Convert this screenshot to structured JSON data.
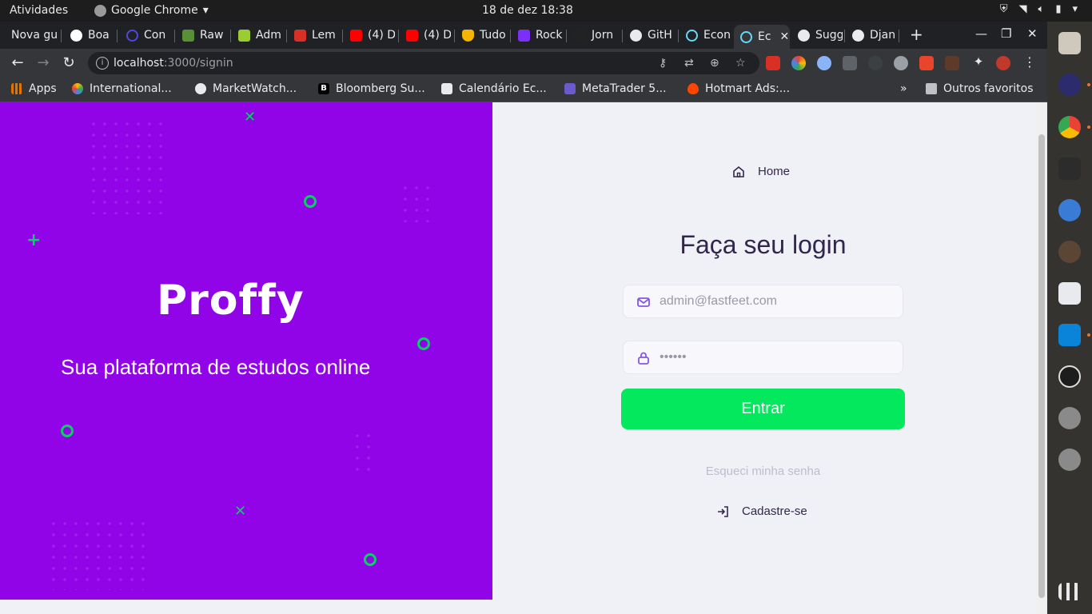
{
  "topbar": {
    "activities": "Atividades",
    "app_name": "Google Chrome",
    "clock": "18 de dez  18:38"
  },
  "tabs": [
    {
      "label": "Nova gu",
      "color": "#202124"
    },
    {
      "label": "Boa",
      "color": "#ffffff"
    },
    {
      "label": "Con",
      "color": "#4f46e5"
    },
    {
      "label": "Raw",
      "color": "#5a8f3a"
    },
    {
      "label": "Adm",
      "color": "#9acd32"
    },
    {
      "label": "Lem",
      "color": "#d93025"
    },
    {
      "label": "(4) D",
      "color": "#ff0000"
    },
    {
      "label": "(4) D",
      "color": "#ff0000"
    },
    {
      "label": "Tudo",
      "color": "#f4b400"
    },
    {
      "label": "Rock",
      "color": "#7b2ff7"
    },
    {
      "label": "Jorn",
      "color": "#222222"
    },
    {
      "label": "GitH",
      "color": "#e8eaed"
    },
    {
      "label": "Econ",
      "color": "#61dafb"
    },
    {
      "label": "Ec",
      "color": "#61dafb"
    },
    {
      "label": "Sugg",
      "color": "#e8eaed"
    },
    {
      "label": "Djan",
      "color": "#e8eaed"
    }
  ],
  "toolbar": {
    "url_host": "localhost",
    "url_path": ":3000/signin"
  },
  "bookmarks": [
    {
      "label": "Apps",
      "color": "#e37400"
    },
    {
      "label": "International...",
      "color": "#e8eaed"
    },
    {
      "label": "MarketWatch...",
      "color": "#e8eaed"
    },
    {
      "label": "Bloomberg Su...",
      "color": "#000000"
    },
    {
      "label": "Calendário Ec...",
      "color": "#e8eaed"
    },
    {
      "label": "MetaTrader 5...",
      "color": "#6a5acd"
    },
    {
      "label": "Hotmart Ads:...",
      "color": "#ff4500"
    },
    {
      "label": "Outros favoritos",
      "color": "#bdc1c6"
    }
  ],
  "hero": {
    "logo": "Proffy",
    "slogan": "Sua plataforma de estudos online"
  },
  "form": {
    "home_link": "Home",
    "title": "Faça seu login",
    "email_placeholder": "admin@fastfeet.com",
    "password_value": "••••••",
    "submit_label": "Entrar",
    "forgot_password": "Esqueci minha senha",
    "signup_link": "Cadastre-se"
  },
  "colors": {
    "hero_bg": "#9104e8",
    "accent_green": "#04e85d",
    "title_text": "#32264d"
  }
}
